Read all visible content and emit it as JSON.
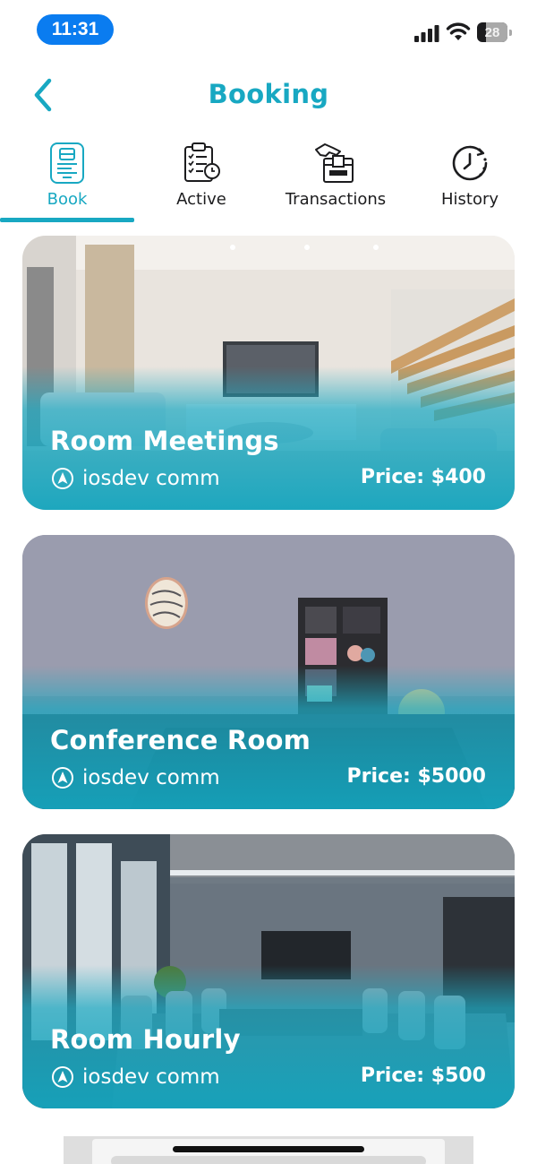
{
  "status_bar": {
    "time": "11:31",
    "battery": "28",
    "battery_level_percent": 28
  },
  "header": {
    "title": "Booking",
    "back_icon": "chevron-left-icon",
    "accent_color": "#18a8c2"
  },
  "tabs": [
    {
      "label": "Book",
      "icon": "booking-form-icon",
      "active": true
    },
    {
      "label": "Active",
      "icon": "clipboard-checklist-clock-icon",
      "active": false
    },
    {
      "label": "Transactions",
      "icon": "hand-card-payment-icon",
      "active": false
    },
    {
      "label": "History",
      "icon": "clock-history-icon",
      "active": false
    }
  ],
  "rooms": [
    {
      "name": "Room Meetings",
      "location": "iosdev comm",
      "price": "Price: $400"
    },
    {
      "name": "Conference Room",
      "location": "iosdev comm",
      "price": "Price: $5000"
    },
    {
      "name": "Room Hourly",
      "location": "iosdev comm",
      "price": "Price: $500"
    }
  ]
}
